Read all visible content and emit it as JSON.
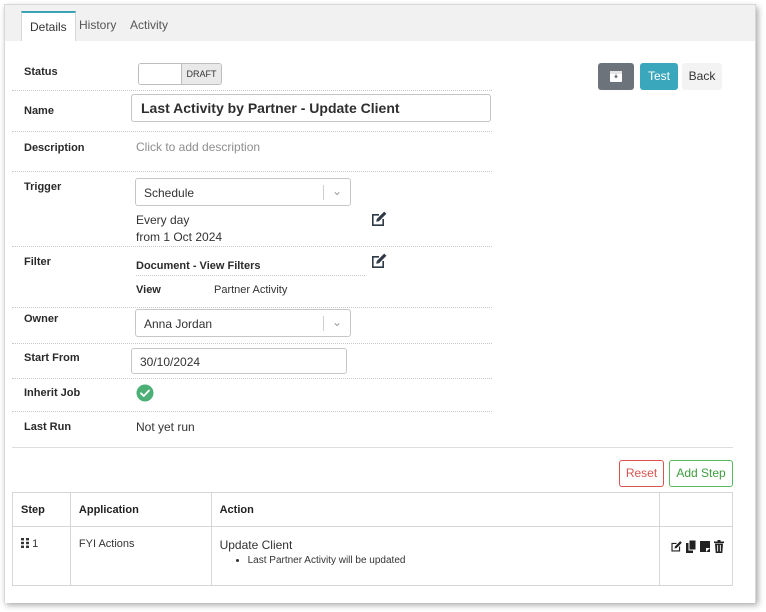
{
  "tabs": [
    {
      "label": "Details"
    },
    {
      "label": "History"
    },
    {
      "label": "Activity"
    }
  ],
  "form": {
    "status_label": "Status",
    "status_value": "DRAFT",
    "name_label": "Name",
    "name_value": "Last Activity by Partner - Update Client",
    "description_label": "Description",
    "description_placeholder": "Click to add description",
    "trigger_label": "Trigger",
    "trigger_value": "Schedule",
    "trigger_schedule_line1": "Every day",
    "trigger_schedule_line2": "from 1 Oct 2024",
    "filter_label": "Filter",
    "filter_title": "Document - View Filters",
    "filter_view_label": "View",
    "filter_view_value": "Partner Activity",
    "owner_label": "Owner",
    "owner_value": "Anna Jordan",
    "start_from_label": "Start From",
    "start_from_value": "30/10/2024",
    "inherit_job_label": "Inherit Job",
    "last_run_label": "Last Run",
    "last_run_value": "Not yet run"
  },
  "toolbar": {
    "test_label": "Test",
    "back_label": "Back"
  },
  "steps_toolbar": {
    "reset_label": "Reset",
    "add_step_label": "Add Step"
  },
  "steps_table": {
    "columns": [
      "Step",
      "Application",
      "Action",
      ""
    ],
    "rows": [
      {
        "step": "1",
        "application": "FYI Actions",
        "action_title": "Update Client",
        "action_bullets": [
          "Last Partner Activity will be updated"
        ]
      }
    ]
  },
  "colors": {
    "accent": "#3ba7bd",
    "archive": "#6c737a",
    "reset": "#d9534f",
    "add": "#5cb85c",
    "success": "#4caf76"
  }
}
